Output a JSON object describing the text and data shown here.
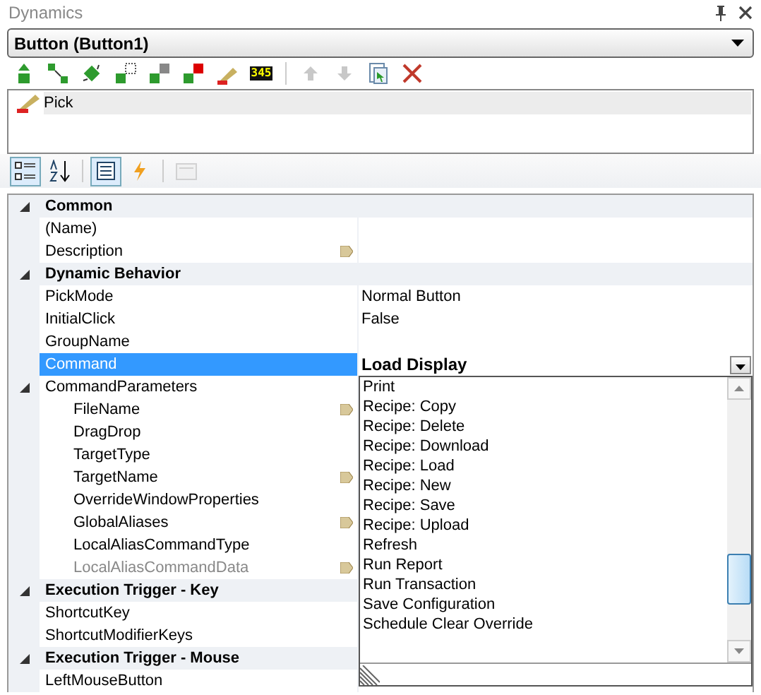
{
  "panel": {
    "title": "Dynamics"
  },
  "object_selector": {
    "value": "Button (Button1)"
  },
  "toolbar": [
    {
      "kind": "add"
    },
    {
      "kind": "connect"
    },
    {
      "kind": "rotate"
    },
    {
      "kind": "outline"
    },
    {
      "kind": "stack"
    },
    {
      "kind": "highlight"
    },
    {
      "kind": "pick"
    },
    {
      "kind": "display",
      "label": "345"
    },
    {
      "kind": "separator"
    },
    {
      "kind": "up",
      "disabled": true
    },
    {
      "kind": "down",
      "disabled": true
    },
    {
      "kind": "copy"
    },
    {
      "kind": "delete"
    }
  ],
  "dynamics_list": [
    {
      "label": "Pick",
      "selected": true
    }
  ],
  "grid_toolbar": [
    {
      "kind": "categorized",
      "selected": true
    },
    {
      "kind": "alphabetical",
      "selected": false
    },
    {
      "kind": "separator"
    },
    {
      "kind": "properties",
      "selected": true
    },
    {
      "kind": "events",
      "selected": false
    },
    {
      "kind": "separator"
    },
    {
      "kind": "pages",
      "selected": false,
      "disabled": true
    }
  ],
  "properties": [
    {
      "kind": "category",
      "label": "Common",
      "expanded": true,
      "children": [
        {
          "name": "(Name)",
          "selected": false,
          "editor": false,
          "disabled": false
        },
        {
          "name": "Description",
          "selected": false,
          "editor": true,
          "disabled": false
        }
      ]
    },
    {
      "kind": "category",
      "label": "Dynamic Behavior",
      "expanded": true,
      "children": [
        {
          "name": "PickMode",
          "value": "Normal Button",
          "modified": false,
          "selected": false,
          "editor": false,
          "disabled": false
        },
        {
          "name": "InitialClick",
          "value": "False",
          "modified": false,
          "selected": false,
          "editor": false,
          "disabled": false
        },
        {
          "name": "GroupName",
          "selected": false,
          "editor": false,
          "disabled": false
        },
        {
          "name": "Command",
          "value": "Load Display",
          "modified": true,
          "dropdown_open": true,
          "selected": true,
          "editor": false,
          "disabled": false
        },
        {
          "name": "CommandParameters",
          "expanded": true,
          "selected": false,
          "editor": false,
          "disabled": false,
          "children": [
            {
              "name": "FileName",
              "selected": false,
              "editor": true,
              "disabled": false
            },
            {
              "name": "DragDrop",
              "selected": false,
              "editor": false,
              "disabled": false
            },
            {
              "name": "TargetType",
              "selected": false,
              "editor": false,
              "disabled": false
            },
            {
              "name": "TargetName",
              "selected": false,
              "editor": true,
              "disabled": false
            },
            {
              "name": "OverrideWindowProperties",
              "selected": false,
              "editor": false,
              "disabled": false
            },
            {
              "name": "GlobalAliases",
              "selected": false,
              "editor": true,
              "disabled": false
            },
            {
              "name": "LocalAliasCommandType",
              "selected": false,
              "editor": false,
              "disabled": false
            },
            {
              "name": "LocalAliasCommandData",
              "selected": false,
              "editor": true,
              "disabled": true
            }
          ]
        }
      ]
    },
    {
      "kind": "category",
      "label": "Execution Trigger - Key",
      "expanded": true,
      "children": [
        {
          "name": "ShortcutKey",
          "selected": false,
          "editor": false,
          "disabled": false
        },
        {
          "name": "ShortcutModifierKeys",
          "selected": false,
          "editor": false,
          "disabled": false
        }
      ]
    },
    {
      "kind": "category",
      "label": "Execution Trigger - Mouse",
      "expanded": true,
      "children": [
        {
          "name": "LeftMouseButton",
          "selected": false,
          "editor": false,
          "disabled": false
        }
      ]
    }
  ],
  "command_dropdown": {
    "items": [
      "Print",
      "Recipe: Copy",
      "Recipe: Delete",
      "Recipe: Download",
      "Recipe: Load",
      "Recipe: New",
      "Recipe: Save",
      "Recipe: Upload",
      "Refresh",
      "Run Report",
      "Run Transaction",
      "Save Configuration",
      "Schedule Clear Override"
    ]
  }
}
